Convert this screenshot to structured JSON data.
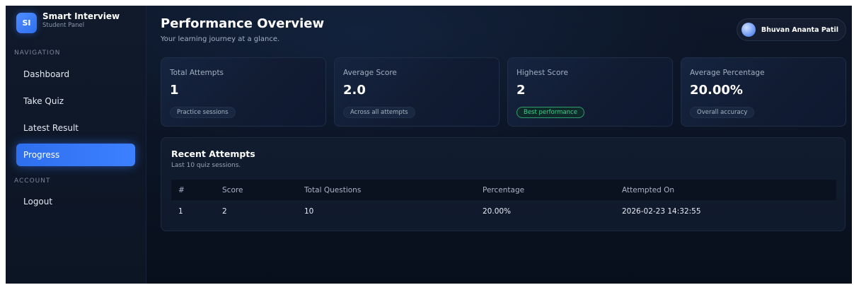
{
  "brand": {
    "badge": "SI",
    "name": "Smart Interview",
    "subtitle": "Student Panel"
  },
  "sidebar": {
    "nav_label": "NAVIGATION",
    "nav_items": [
      {
        "label": "Dashboard"
      },
      {
        "label": "Take Quiz"
      },
      {
        "label": "Latest Result"
      },
      {
        "label": "Progress",
        "active": true
      }
    ],
    "account_label": "ACCOUNT",
    "account_items": [
      {
        "label": "Logout"
      }
    ]
  },
  "header": {
    "title": "Performance Overview",
    "subtitle": "Your learning journey at a glance.",
    "user_name": "Bhuvan Ananta Patil"
  },
  "stats": [
    {
      "label": "Total Attempts",
      "value": "1",
      "tag": "Practice sessions"
    },
    {
      "label": "Average Score",
      "value": "2.0",
      "tag": "Across all attempts"
    },
    {
      "label": "Highest Score",
      "value": "2",
      "tag": "Best performance"
    },
    {
      "label": "Average Percentage",
      "value": "20.00%",
      "tag": "Overall accuracy"
    }
  ],
  "recent": {
    "title": "Recent Attempts",
    "subtitle": "Last 10 quiz sessions.",
    "columns": [
      "#",
      "Score",
      "Total Questions",
      "Percentage",
      "Attempted On"
    ],
    "rows": [
      [
        "1",
        "2",
        "10",
        "20.00%",
        "2026-02-23 14:32:55"
      ]
    ]
  },
  "colors": {
    "accent": "#3d80ff",
    "background": "#0b1322",
    "success": "#3fd08a"
  }
}
